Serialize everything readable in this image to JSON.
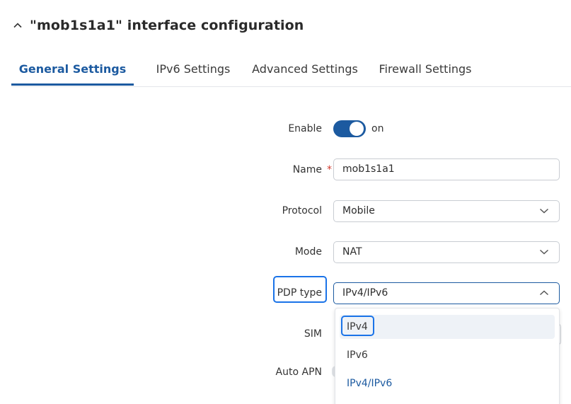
{
  "header": {
    "title": "\"mob1s1a1\" interface configuration"
  },
  "tabs": [
    {
      "label": "General Settings",
      "active": true
    },
    {
      "label": "IPv6 Settings",
      "active": false
    },
    {
      "label": "Advanced Settings",
      "active": false
    },
    {
      "label": "Firewall Settings",
      "active": false
    }
  ],
  "form": {
    "enable": {
      "label": "Enable",
      "state": "on"
    },
    "name": {
      "label": "Name",
      "required_mark": "*",
      "value": "mob1s1a1"
    },
    "protocol": {
      "label": "Protocol",
      "value": "Mobile"
    },
    "mode": {
      "label": "Mode",
      "value": "NAT"
    },
    "pdp_type": {
      "label": "PDP type",
      "value": "IPv4/IPv6",
      "options": [
        "IPv4",
        "IPv6",
        "IPv4/IPv6"
      ]
    },
    "sim": {
      "label": "SIM"
    },
    "auto_apn": {
      "label": "Auto APN"
    }
  },
  "colors": {
    "accent": "#1c5aa0",
    "highlight": "#1a73e8",
    "required": "#d23b2f"
  }
}
